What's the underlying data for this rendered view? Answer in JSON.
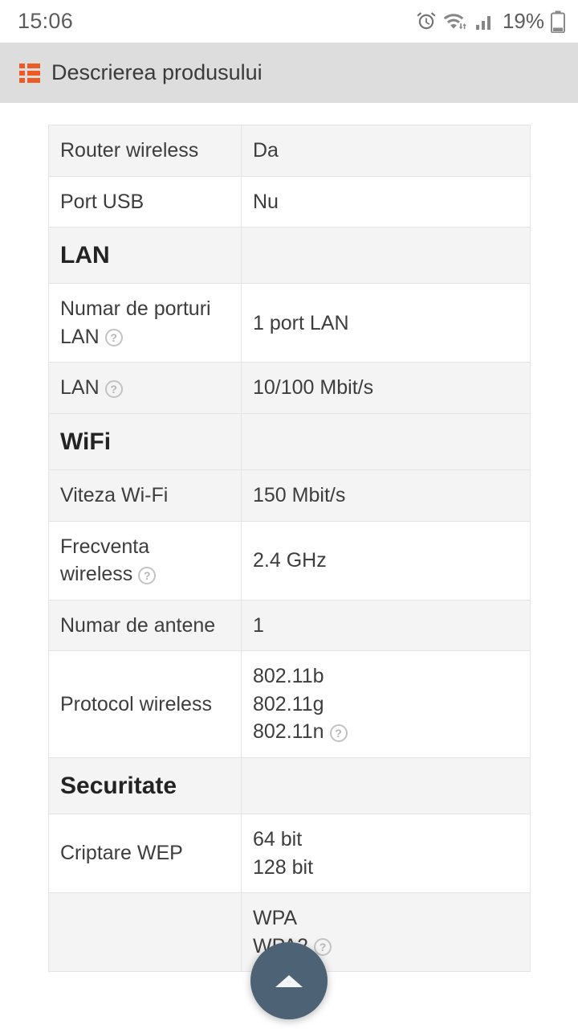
{
  "status_bar": {
    "time": "15:06",
    "battery_percent": "19%",
    "icons": [
      "alarm-icon",
      "wifi-icon",
      "signal-icon",
      "battery-icon"
    ]
  },
  "header": {
    "title": "Descrierea produsului",
    "icon": "list-table-icon",
    "icon_color": "#ee5a24",
    "background": "#dddddd"
  },
  "fab": {
    "name": "scroll-to-top-button",
    "icon": "arrow-up-icon",
    "color": "#4e6275"
  },
  "spec_table": {
    "rows": [
      {
        "type": "data",
        "key": "Router wireless",
        "key_help": false,
        "values": [
          "Da"
        ],
        "value_help": false,
        "shade": true
      },
      {
        "type": "data",
        "key": "Port USB",
        "key_help": false,
        "values": [
          "Nu"
        ],
        "value_help": false,
        "shade": false
      },
      {
        "type": "section",
        "key": "LAN",
        "key_help": false,
        "values": [],
        "value_help": false,
        "shade": true
      },
      {
        "type": "data",
        "key": "Numar de porturi LAN",
        "key_help": true,
        "values": [
          "1 port LAN"
        ],
        "value_help": false,
        "shade": false
      },
      {
        "type": "data",
        "key": "LAN",
        "key_help": true,
        "values": [
          "10/100 Mbit/s"
        ],
        "value_help": false,
        "shade": true
      },
      {
        "type": "section",
        "key": "WiFi",
        "key_help": false,
        "values": [],
        "value_help": false,
        "shade": false
      },
      {
        "type": "data",
        "key": "Viteza Wi-Fi",
        "key_help": false,
        "values": [
          "150 Mbit/s"
        ],
        "value_help": false,
        "shade": true
      },
      {
        "type": "data",
        "key": "Frecventa wireless",
        "key_help": true,
        "values": [
          "2.4 GHz"
        ],
        "value_help": false,
        "shade": false
      },
      {
        "type": "data",
        "key": "Numar de antene",
        "key_help": false,
        "values": [
          "1"
        ],
        "value_help": false,
        "shade": true
      },
      {
        "type": "data",
        "key": "Protocol wireless",
        "key_help": false,
        "values": [
          "802.11b",
          "802.11g",
          "802.11n"
        ],
        "value_help": true,
        "shade": false
      },
      {
        "type": "section",
        "key": "Securitate",
        "key_help": false,
        "values": [],
        "value_help": false,
        "shade": true
      },
      {
        "type": "data",
        "key": "Criptare WEP",
        "key_help": false,
        "values": [
          "64 bit",
          "128 bit"
        ],
        "value_help": false,
        "shade": false
      },
      {
        "type": "data",
        "key": "",
        "key_help": false,
        "values": [
          "WPA",
          "WPA2"
        ],
        "value_help": true,
        "shade": true
      }
    ]
  }
}
